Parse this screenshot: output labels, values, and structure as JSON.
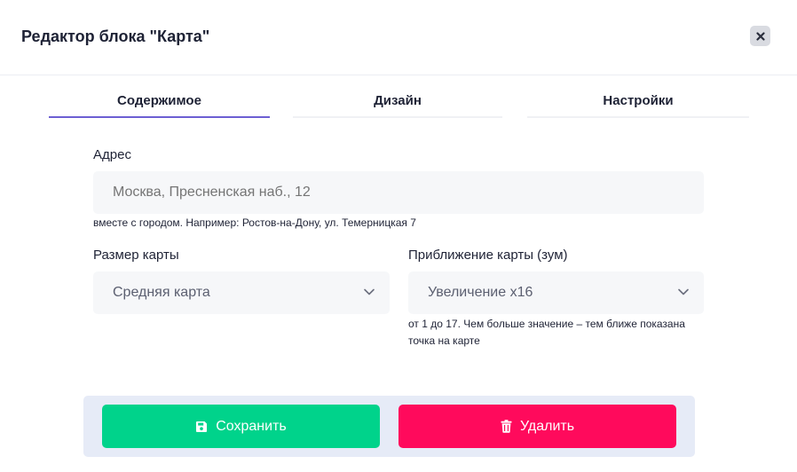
{
  "dialog": {
    "title": "Редактор блока \"Карта\"",
    "close_icon": "close-icon"
  },
  "tabs": [
    {
      "label": "Содержимое",
      "active": true
    },
    {
      "label": "Дизайн",
      "active": false
    },
    {
      "label": "Настройки",
      "active": false
    }
  ],
  "address": {
    "label": "Адрес",
    "value": "",
    "placeholder": "Москва, Пресненская наб., 12",
    "hint": "вместе с городом. Например: Ростов-на-Дону, ул. Темерницкая 7"
  },
  "map_size": {
    "label": "Размер карты",
    "selected": "Средняя карта",
    "icon": "chevron-down-icon"
  },
  "map_zoom": {
    "label": "Приближение карты (зум)",
    "selected": "Увеличение x16",
    "icon": "chevron-down-icon",
    "hint_line1": "от 1 до 17. Чем больше значение – тем ближе показана",
    "hint_line2": "точка на карте"
  },
  "actions": {
    "save_label": "Сохранить",
    "save_icon": "floppy-disk-icon",
    "delete_label": "Удалить",
    "delete_icon": "trash-icon"
  },
  "colors": {
    "accent": "#6d5fd3",
    "save": "#00d38b",
    "delete": "#ff0a5c",
    "footer_bg": "#e6ebf7"
  }
}
